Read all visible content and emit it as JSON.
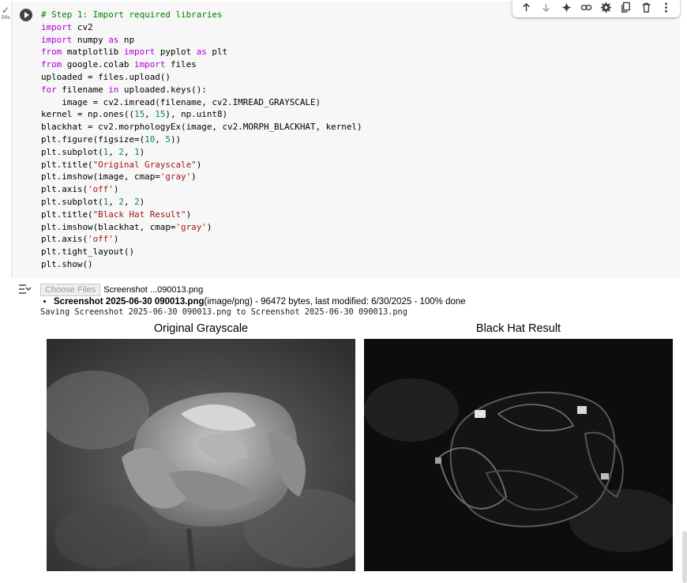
{
  "cell": {
    "status_icon": "check-icon",
    "exec_time": "34s",
    "code_lines": [
      [
        {
          "t": "# Step 1: Import required libraries",
          "c": "cm"
        }
      ],
      [
        {
          "t": "import",
          "c": "kw"
        },
        {
          "t": " cv2",
          "c": "fn"
        }
      ],
      [
        {
          "t": "import",
          "c": "kw"
        },
        {
          "t": " numpy ",
          "c": "fn"
        },
        {
          "t": "as",
          "c": "kw"
        },
        {
          "t": " np",
          "c": "fn"
        }
      ],
      [
        {
          "t": "from",
          "c": "kw"
        },
        {
          "t": " matplotlib ",
          "c": "fn"
        },
        {
          "t": "import",
          "c": "kw"
        },
        {
          "t": " pyplot ",
          "c": "fn"
        },
        {
          "t": "as",
          "c": "kw"
        },
        {
          "t": " plt",
          "c": "fn"
        }
      ],
      [
        {
          "t": "from",
          "c": "kw"
        },
        {
          "t": " google.colab ",
          "c": "fn"
        },
        {
          "t": "import",
          "c": "kw"
        },
        {
          "t": " files",
          "c": "fn"
        }
      ],
      [
        {
          "t": "uploaded = files.upload()",
          "c": "fn"
        }
      ],
      [
        {
          "t": "for",
          "c": "kw"
        },
        {
          "t": " filename ",
          "c": "fn"
        },
        {
          "t": "in",
          "c": "kw"
        },
        {
          "t": " uploaded.keys():",
          "c": "fn"
        }
      ],
      [
        {
          "t": "    image = cv2.imread(filename, cv2.IMREAD_GRAYSCALE)",
          "c": "fn"
        }
      ],
      [
        {
          "t": "kernel = np.ones((",
          "c": "fn"
        },
        {
          "t": "15",
          "c": "nm"
        },
        {
          "t": ", ",
          "c": "fn"
        },
        {
          "t": "15",
          "c": "nm"
        },
        {
          "t": "), np.uint8)",
          "c": "fn"
        }
      ],
      [
        {
          "t": "blackhat = cv2.morphologyEx(image, cv2.MORPH_BLACKHAT, kernel)",
          "c": "fn"
        }
      ],
      [
        {
          "t": "plt.figure(figsize=(",
          "c": "fn"
        },
        {
          "t": "10",
          "c": "nm"
        },
        {
          "t": ", ",
          "c": "fn"
        },
        {
          "t": "5",
          "c": "nm"
        },
        {
          "t": "))",
          "c": "fn"
        }
      ],
      [
        {
          "t": "plt.subplot(",
          "c": "fn"
        },
        {
          "t": "1",
          "c": "nm"
        },
        {
          "t": ", ",
          "c": "fn"
        },
        {
          "t": "2",
          "c": "nm"
        },
        {
          "t": ", ",
          "c": "fn"
        },
        {
          "t": "1",
          "c": "nm"
        },
        {
          "t": ")",
          "c": "fn"
        }
      ],
      [
        {
          "t": "plt.title(",
          "c": "fn"
        },
        {
          "t": "\"Original Grayscale\"",
          "c": "st"
        },
        {
          "t": ")",
          "c": "fn"
        }
      ],
      [
        {
          "t": "plt.imshow(image, cmap=",
          "c": "fn"
        },
        {
          "t": "'gray'",
          "c": "st"
        },
        {
          "t": ")",
          "c": "fn"
        }
      ],
      [
        {
          "t": "plt.axis(",
          "c": "fn"
        },
        {
          "t": "'off'",
          "c": "st"
        },
        {
          "t": ")",
          "c": "fn"
        }
      ],
      [
        {
          "t": "plt.subplot(",
          "c": "fn"
        },
        {
          "t": "1",
          "c": "nm"
        },
        {
          "t": ", ",
          "c": "fn"
        },
        {
          "t": "2",
          "c": "nm"
        },
        {
          "t": ", ",
          "c": "fn"
        },
        {
          "t": "2",
          "c": "nm"
        },
        {
          "t": ")",
          "c": "fn"
        }
      ],
      [
        {
          "t": "plt.title(",
          "c": "fn"
        },
        {
          "t": "\"Black Hat Result\"",
          "c": "st"
        },
        {
          "t": ")",
          "c": "fn"
        }
      ],
      [
        {
          "t": "plt.imshow(blackhat, cmap=",
          "c": "fn"
        },
        {
          "t": "'gray'",
          "c": "st"
        },
        {
          "t": ")",
          "c": "fn"
        }
      ],
      [
        {
          "t": "plt.axis(",
          "c": "fn"
        },
        {
          "t": "'off'",
          "c": "st"
        },
        {
          "t": ")",
          "c": "fn"
        }
      ],
      [
        {
          "t": "plt.tight_layout()",
          "c": "fn"
        }
      ],
      [
        {
          "t": "plt.show()",
          "c": "fn"
        }
      ]
    ]
  },
  "toolbar": {
    "items": [
      "move-up-icon",
      "move-down-icon",
      "gemini-sparkle-icon",
      "link-icon",
      "gear-icon",
      "mirror-cell-icon",
      "delete-icon",
      "more-vert-icon"
    ]
  },
  "output": {
    "choose_files_label": "Choose Files",
    "selected_file": "Screenshot ...090013.png",
    "file_entry_name": "Screenshot 2025-06-30 090013.png",
    "file_entry_details": "(image/png) - 96472 bytes, last modified: 6/30/2025 - 100% done",
    "saving_line": "Saving Screenshot 2025-06-30 090013.png to Screenshot 2025-06-30 090013.png"
  },
  "figure": {
    "left_title": "Original Grayscale",
    "right_title": "Black Hat Result"
  },
  "colors": {
    "check": "#188038",
    "keyword": "#af00db",
    "comment": "#008000",
    "string": "#a31515",
    "number": "#098658"
  }
}
